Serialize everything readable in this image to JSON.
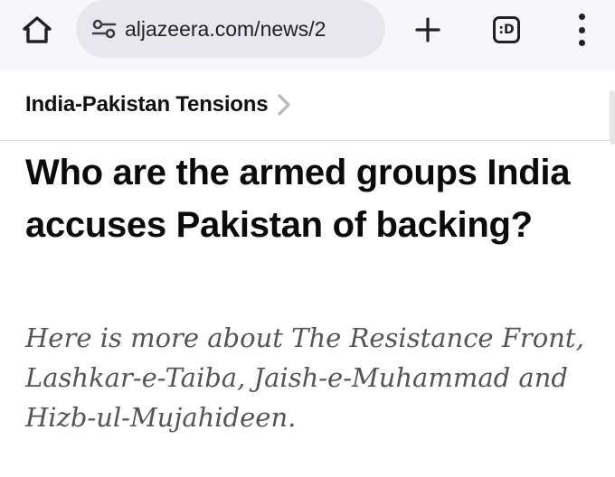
{
  "browser": {
    "url": "aljazeera.com/news/2",
    "tabs_label": ":D",
    "icons": {
      "home": "home-icon",
      "tune": "site-settings-icon",
      "new_tab": "plus-icon",
      "tabs": "tab-switcher-icon",
      "menu": "more-vert-icon"
    }
  },
  "section": {
    "label": "India-Pakistan Tensions"
  },
  "article": {
    "headline": "Who are the armed groups India accuses Pakistan of backing?",
    "summary": "Here is more about The Resistance Front, Lashkar-e-Taiba, Jaish-e-Muhammad and Hizb-ul-Mujahideen."
  }
}
